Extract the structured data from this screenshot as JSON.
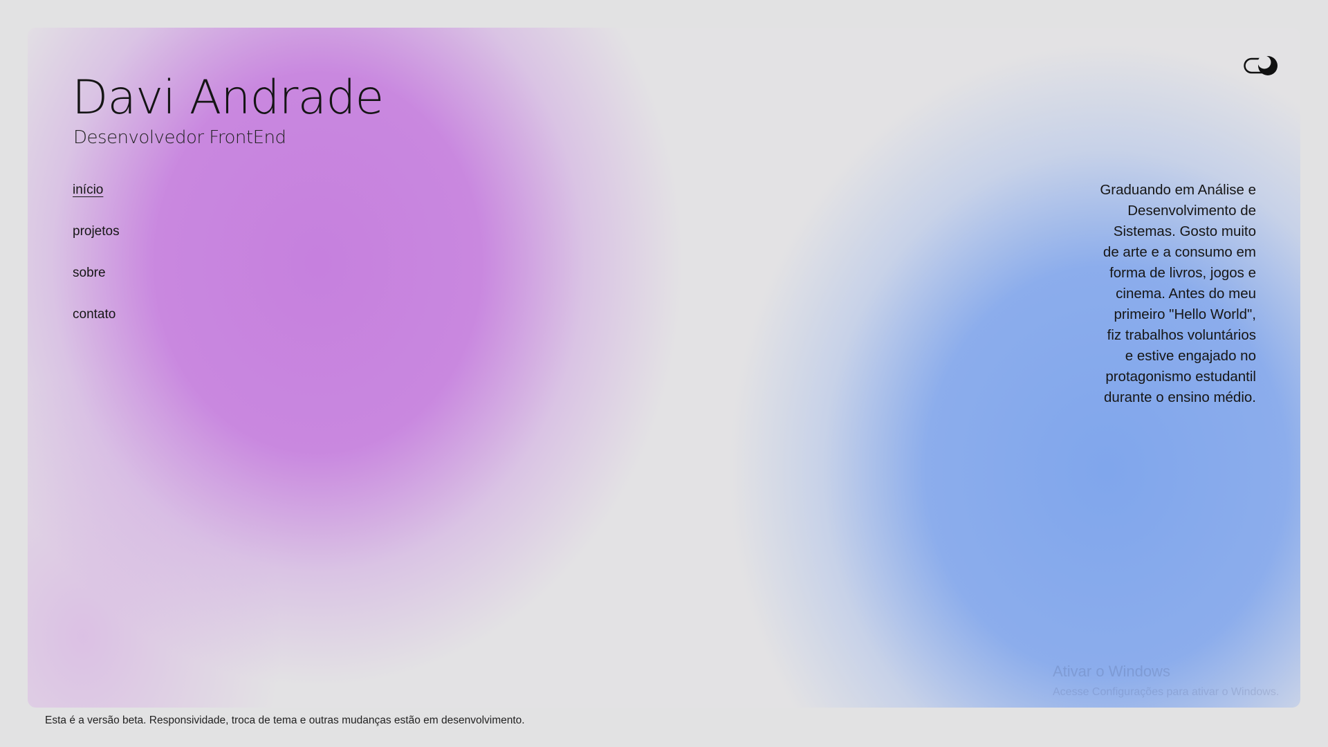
{
  "header": {
    "name": "Davi Andrade",
    "role": "Desenvolvedor FrontEnd"
  },
  "theme_toggle": {
    "icon": "moon-toggle-icon",
    "state": "dark-moon"
  },
  "nav": {
    "items": [
      {
        "label": "início",
        "active": true
      },
      {
        "label": "projetos",
        "active": false
      },
      {
        "label": "sobre",
        "active": false
      },
      {
        "label": "contato",
        "active": false
      }
    ]
  },
  "bio": {
    "text": "Graduando em Análise e Desenvolvimento de Sistemas. Gosto muito de arte e a consumo em forma de livros, jogos e cinema. Antes do meu primeiro \"Hello World\", fiz trabalhos voluntários e estive engajado no protagonismo estudantil durante o ensino médio."
  },
  "watermark": {
    "title": "Ativar o Windows",
    "subtitle": "Acesse Configurações para ativar o Windows."
  },
  "footer": {
    "notice": "Esta é a versão beta. Responsividade, troca de tema e outras mudanças estão em desenvolvimento."
  },
  "colors": {
    "background": "#e2e2e3",
    "purple_blob": "#c680de",
    "blue_blob": "#80a6ec",
    "text": "#141414"
  }
}
